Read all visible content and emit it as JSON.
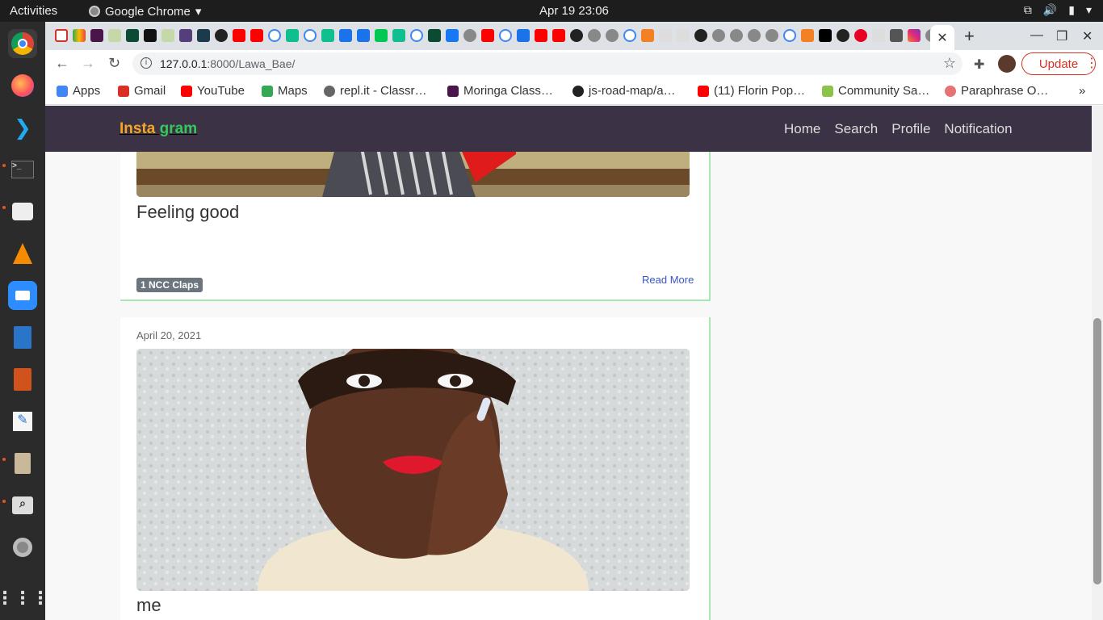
{
  "system": {
    "activities": "Activities",
    "app_name": "Google Chrome",
    "clock": "Apr 19  23:06"
  },
  "browser": {
    "url_host": "127.0.0.1",
    "url_path": ":8000/Lawa_Bae/",
    "update_label": "Update",
    "bookmarks": [
      {
        "label": "Apps",
        "color": "#4285f4"
      },
      {
        "label": "Gmail",
        "color": "#d93025"
      },
      {
        "label": "YouTube",
        "color": "#ff0000"
      },
      {
        "label": "Maps",
        "color": "#34a853"
      },
      {
        "label": "repl.it - Classr…",
        "color": "#666666"
      },
      {
        "label": "Moringa Class…",
        "color": "#4a154b"
      },
      {
        "label": "js-road-map/a…",
        "color": "#222222"
      },
      {
        "label": "(11) Florin Pop…",
        "color": "#ff0000"
      },
      {
        "label": "Community Sa…",
        "color": "#8bc34a"
      },
      {
        "label": "Paraphrase O…",
        "color": "#e57373"
      }
    ]
  },
  "site": {
    "brand_part1": "Insta",
    "brand_part2": " gram",
    "nav": [
      "Home",
      "Search",
      "Profile",
      "Notification"
    ]
  },
  "posts": [
    {
      "caption": "Feeling good",
      "claps": "1 NCC Claps",
      "read_more": "Read More"
    },
    {
      "date": "April 20, 2021",
      "caption": "me"
    }
  ]
}
